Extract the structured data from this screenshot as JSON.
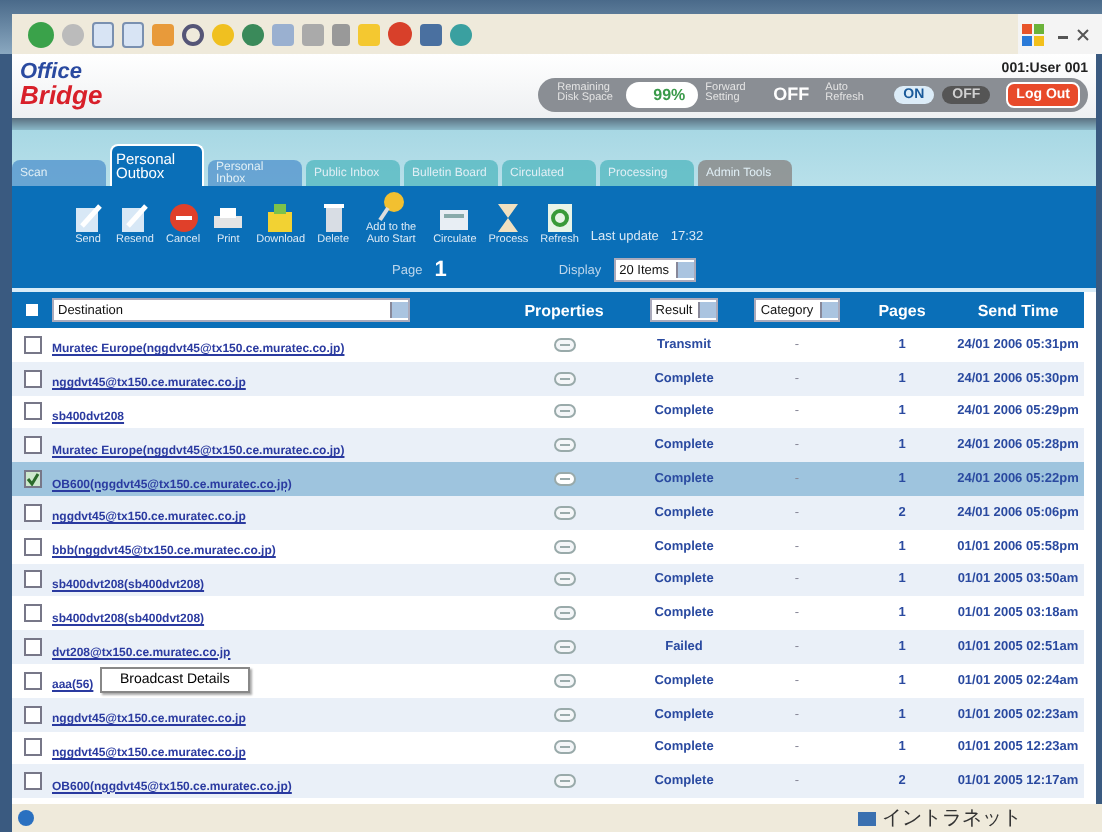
{
  "header": {
    "logo_top": "Office",
    "logo_bottom": "Bridge",
    "user": "001:User 001",
    "disk": {
      "label": "Remaining Disk Space",
      "value": "99%"
    },
    "forward": {
      "label": "Forward Setting",
      "value": "OFF"
    },
    "auto_refresh": {
      "label": "Auto Refresh",
      "on_label": "ON",
      "off_label": "OFF",
      "on": true
    },
    "logout": "Log Out"
  },
  "tabs": [
    {
      "label": "Scan",
      "selected": false,
      "color": "#5b9bd0"
    },
    {
      "label": "Personal Outbox",
      "selected": true,
      "color": "#0a6fb8"
    },
    {
      "label": "Personal Inbox",
      "selected": false,
      "color": "#5b9bd0"
    },
    {
      "label": "Public Inbox",
      "selected": false,
      "color": "#5cbcc4"
    },
    {
      "label": "Bulletin Board",
      "selected": false,
      "color": "#5cbcc4"
    },
    {
      "label": "Circulated",
      "selected": false,
      "color": "#5cbcc4"
    },
    {
      "label": "Processing",
      "selected": false,
      "color": "#5cbcc4"
    },
    {
      "label": "Admin Tools",
      "selected": false,
      "color": "#8c8c8c"
    }
  ],
  "toolbar": [
    {
      "label": "Send",
      "kind": "pen"
    },
    {
      "label": "Resend",
      "kind": "pen"
    },
    {
      "label": "Cancel",
      "kind": "stop"
    },
    {
      "label": "Print",
      "kind": "printer"
    },
    {
      "label": "Download",
      "kind": "folder"
    },
    {
      "label": "Delete",
      "kind": "trash"
    },
    {
      "label": "Add to the Auto Start",
      "kind": "pin"
    },
    {
      "label": "Circulate",
      "kind": "tray"
    },
    {
      "label": "Process",
      "kind": "hourglass"
    },
    {
      "label": "Refresh",
      "kind": "refresh"
    }
  ],
  "last_update": {
    "label": "Last update",
    "value": "17:32"
  },
  "page": {
    "label": "Page",
    "value": "1"
  },
  "display": {
    "label": "Display",
    "value": "20 Items"
  },
  "table": {
    "destination": "Destination",
    "properties": "Properties",
    "result": "Result",
    "category": "Category",
    "pages": "Pages",
    "send_time": "Send Time",
    "select_all_checked": false,
    "rows": [
      {
        "destination": "Muratec Europe(nggdvt45@tx150.ce.muratec.co.jp)",
        "result": "Transmit",
        "category": "-",
        "pages": "1",
        "send_time": "24/01 2006 05:31pm",
        "checked": false,
        "selected": false
      },
      {
        "destination": "nggdvt45@tx150.ce.muratec.co.jp",
        "result": "Complete",
        "category": "-",
        "pages": "1",
        "send_time": "24/01 2006 05:30pm",
        "checked": false,
        "selected": false
      },
      {
        "destination": "sb400dvt208",
        "result": "Complete",
        "category": "-",
        "pages": "1",
        "send_time": "24/01 2006 05:29pm",
        "checked": false,
        "selected": false
      },
      {
        "destination": "Muratec Europe(nggdvt45@tx150.ce.muratec.co.jp)",
        "result": "Complete",
        "category": "-",
        "pages": "1",
        "send_time": "24/01 2006 05:28pm",
        "checked": false,
        "selected": false
      },
      {
        "destination": "OB600(nggdvt45@tx150.ce.muratec.co.jp)",
        "result": "Complete",
        "category": "-",
        "pages": "1",
        "send_time": "24/01 2006 05:22pm",
        "checked": true,
        "selected": true
      },
      {
        "destination": "nggdvt45@tx150.ce.muratec.co.jp",
        "result": "Complete",
        "category": "-",
        "pages": "2",
        "send_time": "24/01 2006 05:06pm",
        "checked": false,
        "selected": false
      },
      {
        "destination": "bbb(nggdvt45@tx150.ce.muratec.co.jp)",
        "result": "Complete",
        "category": "-",
        "pages": "1",
        "send_time": "01/01 2006 05:58pm",
        "checked": false,
        "selected": false
      },
      {
        "destination": "sb400dvt208(sb400dvt208)",
        "result": "Complete",
        "category": "-",
        "pages": "1",
        "send_time": "01/01 2005 03:50am",
        "checked": false,
        "selected": false
      },
      {
        "destination": "sb400dvt208(sb400dvt208)",
        "result": "Complete",
        "category": "-",
        "pages": "1",
        "send_time": "01/01 2005 03:18am",
        "checked": false,
        "selected": false
      },
      {
        "destination": "dvt208@tx150.ce.muratec.co.jp",
        "result": "Failed",
        "category": "-",
        "pages": "1",
        "send_time": "01/01 2005 02:51am",
        "checked": false,
        "selected": false
      },
      {
        "destination": "aaa(56)",
        "tooltip": "Broadcast Details",
        "result": "Complete",
        "category": "-",
        "pages": "1",
        "send_time": "01/01 2005 02:24am",
        "checked": false,
        "selected": false
      },
      {
        "destination": "nggdvt45@tx150.ce.muratec.co.jp",
        "result": "Complete",
        "category": "-",
        "pages": "1",
        "send_time": "01/01 2005 02:23am",
        "checked": false,
        "selected": false
      },
      {
        "destination": "nggdvt45@tx150.ce.muratec.co.jp",
        "result": "Complete",
        "category": "-",
        "pages": "1",
        "send_time": "01/01 2005 12:23am",
        "checked": false,
        "selected": false
      },
      {
        "destination": "OB600(nggdvt45@tx150.ce.muratec.co.jp)",
        "result": "Complete",
        "category": "-",
        "pages": "2",
        "send_time": "01/01 2005 12:17am",
        "checked": false,
        "selected": false
      }
    ]
  },
  "status_bar": {
    "zone": "イントラネット"
  }
}
